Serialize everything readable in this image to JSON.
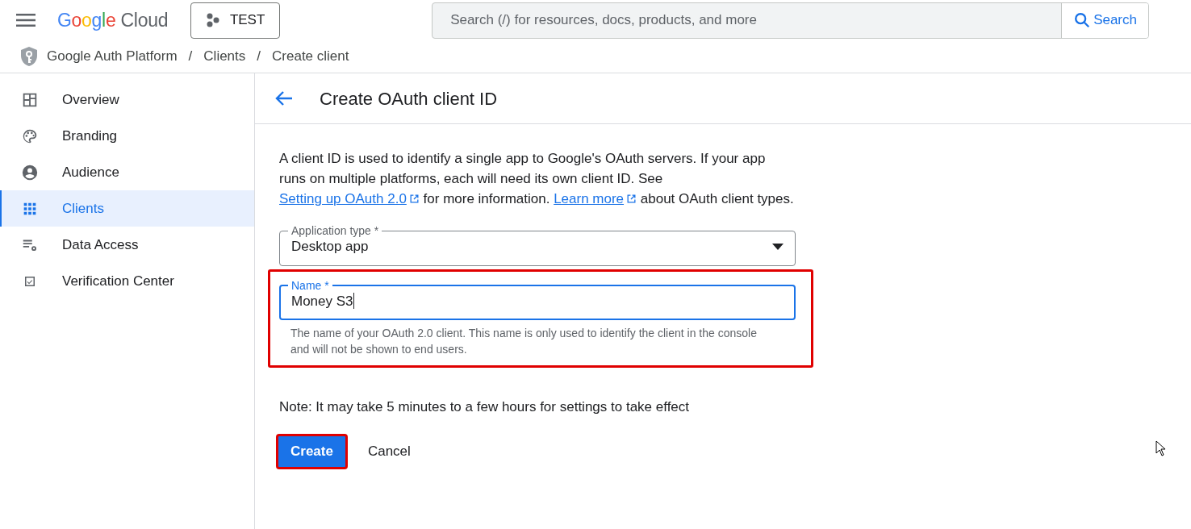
{
  "header": {
    "logo": "Google Cloud",
    "project": "TEST",
    "search": {
      "placeholder": "Search (/) for resources, docs, products, and more",
      "button": "Search"
    }
  },
  "breadcrumb": {
    "separator": "/",
    "items": [
      "Google Auth Platform",
      "Clients",
      "Create client"
    ]
  },
  "sidebar": {
    "items": [
      {
        "label": "Overview",
        "kind": "dashboard",
        "selected": false
      },
      {
        "label": "Branding",
        "kind": "palette",
        "selected": false
      },
      {
        "label": "Audience",
        "kind": "person",
        "selected": false
      },
      {
        "label": "Clients",
        "kind": "grid",
        "selected": true
      },
      {
        "label": "Data Access",
        "kind": "settings-list",
        "selected": false
      },
      {
        "label": "Verification Center",
        "kind": "check",
        "selected": false
      }
    ]
  },
  "page": {
    "title": "Create OAuth client ID",
    "description": [
      {
        "kind": "text",
        "text": "A client ID is used to identify a single app to Google's OAuth servers. If your app runs on multiple platforms, each will need its own client ID. See "
      },
      {
        "kind": "link",
        "text": "Setting up OAuth 2.0"
      },
      {
        "kind": "text",
        "text": " for more information. "
      },
      {
        "kind": "link",
        "text": "Learn more"
      },
      {
        "kind": "text",
        "text": " about OAuth client types."
      }
    ],
    "application_type": {
      "label": "Application type *",
      "value": "Desktop app"
    },
    "name_field": {
      "label": "Name *",
      "value": "Money S3",
      "focused": true,
      "highlighted": true,
      "helper": "The name of your OAuth 2.0 client. This name is only used to identify the client in the console and will not be shown to end users."
    },
    "note": "Note: It may take 5 minutes to a few hours for settings to take effect",
    "buttons": [
      {
        "label": "Create",
        "kind": "primary",
        "highlighted": true
      },
      {
        "label": "Cancel",
        "kind": "text",
        "highlighted": false
      }
    ]
  }
}
